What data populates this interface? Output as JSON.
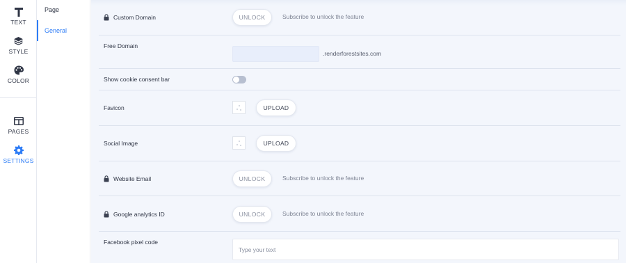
{
  "rail": {
    "items": [
      {
        "label": "TEXT",
        "icon": "text-icon"
      },
      {
        "label": "STYLE",
        "icon": "layers-icon"
      },
      {
        "label": "COLOR",
        "icon": "palette-icon"
      },
      {
        "label": "PAGES",
        "icon": "pages-icon"
      },
      {
        "label": "SETTINGS",
        "icon": "gear-icon",
        "active": true
      }
    ]
  },
  "subnav": {
    "title": "Page",
    "items": [
      {
        "label": "General",
        "active": true
      }
    ]
  },
  "colors": {
    "accent": "#2d7cf6",
    "panel_bg": "#f3f6fc",
    "divider": "#dde3ee"
  },
  "settings": {
    "custom_domain": {
      "label": "Custom Domain",
      "button": "UNLOCK",
      "hint": "Subscribe to unlock the feature",
      "locked": true
    },
    "free_domain": {
      "label": "Free Domain",
      "value": "",
      "suffix": ".renderforestsites.com"
    },
    "cookie_bar": {
      "label": "Show cookie consent bar",
      "enabled": false
    },
    "favicon": {
      "label": "Favicon",
      "button": "UPLOAD"
    },
    "social_image": {
      "label": "Social Image",
      "button": "UPLOAD"
    },
    "website_email": {
      "label": "Website Email",
      "button": "UNLOCK",
      "hint": "Subscribe to unlock the feature",
      "locked": true
    },
    "google_analytics": {
      "label": "Google analytics ID",
      "button": "UNLOCK",
      "hint": "Subscribe to unlock the feature",
      "locked": true
    },
    "facebook_pixel": {
      "label": "Facebook pixel code",
      "placeholder": "Type your text"
    }
  }
}
